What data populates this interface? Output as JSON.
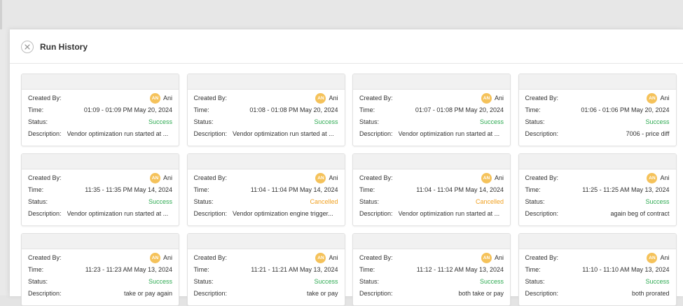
{
  "panel": {
    "title": "Run History"
  },
  "labels": {
    "created_by": "Created By:",
    "time": "Time:",
    "status": "Status:",
    "description": "Description:"
  },
  "colors": {
    "success": "#2eaa52",
    "cancelled": "#f0a020",
    "avatar": "#f5c25a"
  },
  "runs": [
    {
      "avatar": "AN",
      "user": "Ani",
      "time": "01:09 - 01:09 PM May 20, 2024",
      "status": "Success",
      "description": "Vendor optimization run started at ..."
    },
    {
      "avatar": "AN",
      "user": "Ani",
      "time": "01:08 - 01:08 PM May 20, 2024",
      "status": "Success",
      "description": "Vendor optimization run started at ..."
    },
    {
      "avatar": "AN",
      "user": "Ani",
      "time": "01:07 - 01:08 PM May 20, 2024",
      "status": "Success",
      "description": "Vendor optimization run started at ..."
    },
    {
      "avatar": "AN",
      "user": "Ani",
      "time": "01:06 - 01:06 PM May 20, 2024",
      "status": "Success",
      "description": "7006 - price diff"
    },
    {
      "avatar": "AN",
      "user": "Ani",
      "time": "11:35 - 11:35 PM May 14, 2024",
      "status": "Success",
      "description": "Vendor optimization run started at ..."
    },
    {
      "avatar": "AN",
      "user": "Ani",
      "time": "11:04 - 11:04 PM May 14, 2024",
      "status": "Cancelled",
      "description": "Vendor optimization engine trigger..."
    },
    {
      "avatar": "AN",
      "user": "Ani",
      "time": "11:04 - 11:04 PM May 14, 2024",
      "status": "Cancelled",
      "description": "Vendor optimization run started at ..."
    },
    {
      "avatar": "AN",
      "user": "Ani",
      "time": "11:25 - 11:25 AM May 13, 2024",
      "status": "Success",
      "description": "again beg of contract"
    },
    {
      "avatar": "AN",
      "user": "Ani",
      "time": "11:23 - 11:23 AM May 13, 2024",
      "status": "Success",
      "description": "take or pay again"
    },
    {
      "avatar": "AN",
      "user": "Ani",
      "time": "11:21 - 11:21 AM May 13, 2024",
      "status": "Success",
      "description": "take or pay"
    },
    {
      "avatar": "AN",
      "user": "Ani",
      "time": "11:12 - 11:12 AM May 13, 2024",
      "status": "Success",
      "description": "both take or pay"
    },
    {
      "avatar": "AN",
      "user": "Ani",
      "time": "11:10 - 11:10 AM May 13, 2024",
      "status": "Success",
      "description": "both prorated"
    }
  ]
}
